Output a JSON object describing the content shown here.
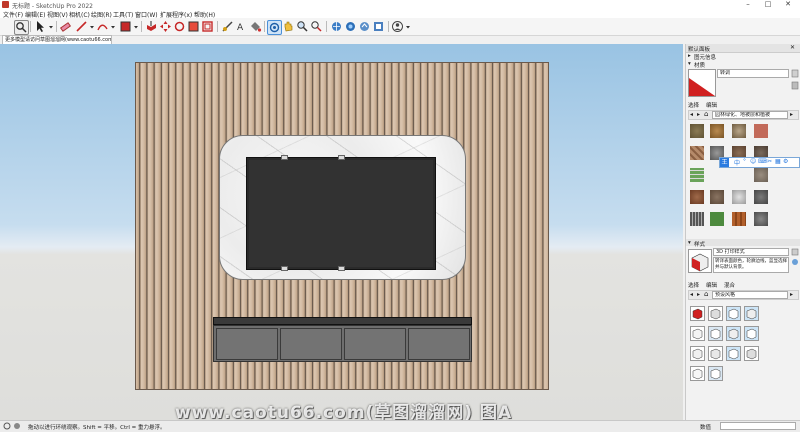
{
  "window": {
    "title": "无标题 - SketchUp Pro 2022"
  },
  "menu": [
    "文件(F)",
    "编辑(E)",
    "视图(V)",
    "相机(C)",
    "绘图(R)",
    "工具(T)",
    "窗口(W)",
    "扩展程序(x)",
    "帮助(H)"
  ],
  "scene_tab": "更多模型请访问草图溜溜网(www.caotu66.com)",
  "right_panel": {
    "default_tray": "默认面板",
    "sections": {
      "layers": "图元信息",
      "materials": "材质",
      "styles": "样式"
    },
    "material_name": "转调",
    "tab_select": "选择",
    "tab_edit": "编辑",
    "tab_mix": "混合",
    "material_library": "园林绿化、地被层和植被",
    "style_title": "3D 打印样式",
    "style_desc": "转译表面颜色，轮廓边线，蓝显选择并与默认背景。",
    "style_library": "预设风格",
    "ime_glyph": "王"
  },
  "status": {
    "text": "拖动以进行环绕观察。Shift = 平移。Ctrl = 重力悬浮。",
    "measure_label": "数值"
  },
  "watermark": "www.caotu66.com(草图溜溜网) 图A",
  "colors": {
    "accent_red": "#d02020",
    "toolbar_blue": "#2c6fb8"
  }
}
